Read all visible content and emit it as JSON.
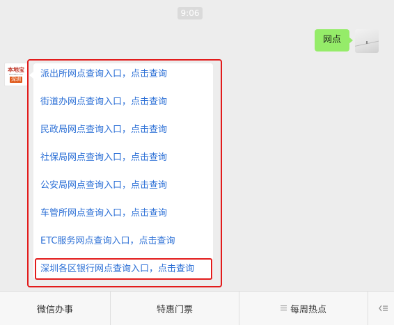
{
  "chat": {
    "timestamp": "9:06",
    "user_message": "网点",
    "bot_avatar": {
      "brand_text": "本地宝",
      "brand_url": "BenDiBao.com",
      "city_text": "深圳"
    },
    "reply_links": [
      "派出所网点查询入口，点击查询",
      "街道办网点查询入口，点击查询",
      "民政局网点查询入口，点击查询",
      "社保局网点查询入口，点击查询",
      "公安局网点查询入口，点击查询",
      "车管所网点查询入口，点击查询",
      "ETC服务网点查询入口，点击查询",
      "深圳各区银行网点查询入口，点击查询"
    ]
  },
  "bottom_menu": {
    "items": [
      "微信办事",
      "特惠门票",
      "每周热点"
    ],
    "item3_icon": "hamburger-icon",
    "keyboard_icon": "keyboard-toggle-icon"
  },
  "colors": {
    "background": "#ededed",
    "user_bubble": "#95ec69",
    "link": "#2b6fd6",
    "highlight_frame": "#e21b1b"
  }
}
